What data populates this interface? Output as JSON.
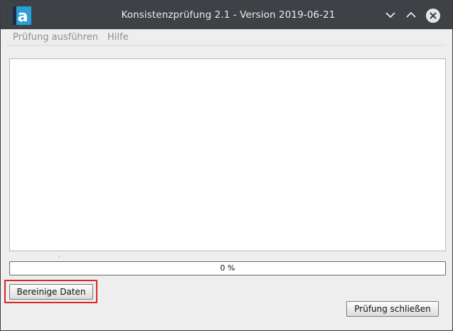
{
  "window": {
    "title": "Konsistenzprüfung 2.1 - Version 2019-06-21",
    "app_icon": "letter-a-icon",
    "controls": [
      "chevron-down-icon",
      "chevron-up-icon",
      "close-icon"
    ]
  },
  "menu": {
    "items": [
      {
        "label": "Prüfung ausführen"
      },
      {
        "label": "Hilfe"
      }
    ]
  },
  "log": {
    "content": ""
  },
  "progress": {
    "value_percent": 0,
    "label": "0 %"
  },
  "buttons": {
    "clean_label": "Bereinige Daten",
    "close_label": "Prüfung schließen"
  },
  "colors": {
    "titlebar": "#3e4246",
    "highlight": "#d42a2a",
    "app_icon_blue": "#2a9fd6"
  }
}
